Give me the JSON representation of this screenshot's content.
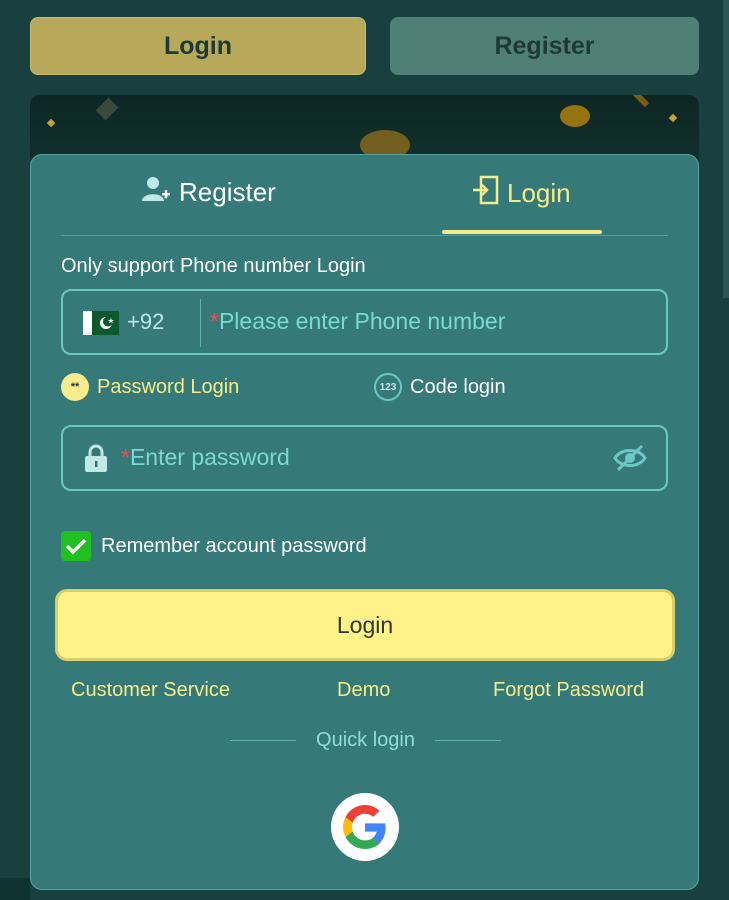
{
  "top_tabs": {
    "login": "Login",
    "register": "Register"
  },
  "tabs": {
    "register": "Register",
    "login": "Login"
  },
  "hint": "Only support Phone number Login",
  "phone": {
    "country_code": "+92",
    "required_mark": "*",
    "placeholder": "Please enter Phone number"
  },
  "modes": {
    "password": "Password Login",
    "password_badge": "**",
    "code": "Code login",
    "code_badge": "123"
  },
  "password": {
    "required_mark": "*",
    "placeholder": "Enter password"
  },
  "remember": {
    "label": "Remember account password",
    "checked": true
  },
  "login_button": "Login",
  "links": {
    "customer_service": "Customer Service",
    "demo": "Demo",
    "forgot": "Forgot Password"
  },
  "quick_login": "Quick login",
  "colors": {
    "accent": "#f7ec8c",
    "card": "#357a78",
    "button": "#fff289",
    "check": "#1fc01f"
  },
  "icons": [
    "user-plus-icon",
    "login-door-icon",
    "pakistan-flag-icon",
    "lock-icon",
    "eye-off-icon",
    "check-icon",
    "google-icon"
  ]
}
